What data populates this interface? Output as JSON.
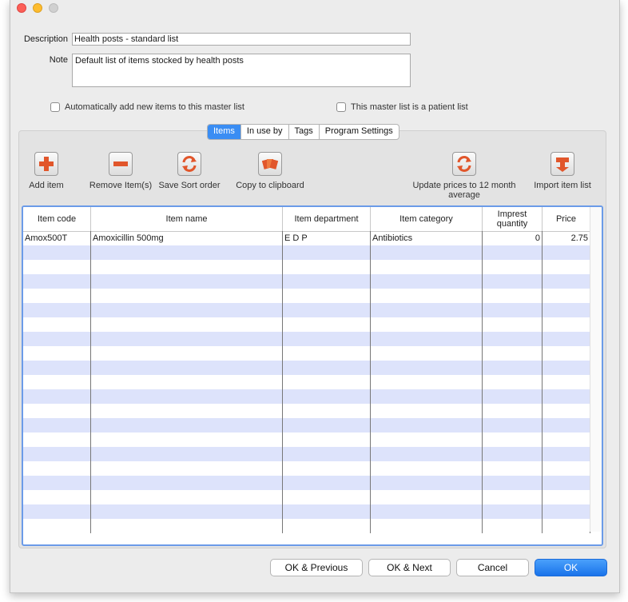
{
  "form": {
    "description_label": "Description",
    "description_value": "Health posts - standard list",
    "note_label": "Note",
    "note_value": "Default list of items stocked by health posts",
    "auto_add_label": "Automatically add new items to this master list",
    "patient_list_label": "This master list is a patient list"
  },
  "tabs": [
    "Items",
    "In use by",
    "Tags",
    "Program Settings"
  ],
  "toolbar": {
    "add_item": "Add item",
    "remove_items": "Remove Item(s)",
    "save_sort": "Save Sort order",
    "copy_clipboard": "Copy to clipboard",
    "update_prices_line1": "Update prices to 12 month",
    "update_prices_line2": "average",
    "import_list": "Import item list"
  },
  "table": {
    "headers": {
      "item_code": "Item code",
      "item_name": "Item name",
      "item_department": "Item department",
      "item_category": "Item category",
      "imprest_line1": "Imprest",
      "imprest_line2": "quantity",
      "price": "Price"
    },
    "rows": [
      {
        "code": "Amox500T",
        "name": "Amoxicillin 500mg",
        "department": "E D P",
        "category": "Antibiotics",
        "imprest": "0",
        "price": "2.75"
      }
    ]
  },
  "buttons": {
    "ok_previous": "OK & Previous",
    "ok_next": "OK & Next",
    "cancel": "Cancel",
    "ok": "OK"
  }
}
